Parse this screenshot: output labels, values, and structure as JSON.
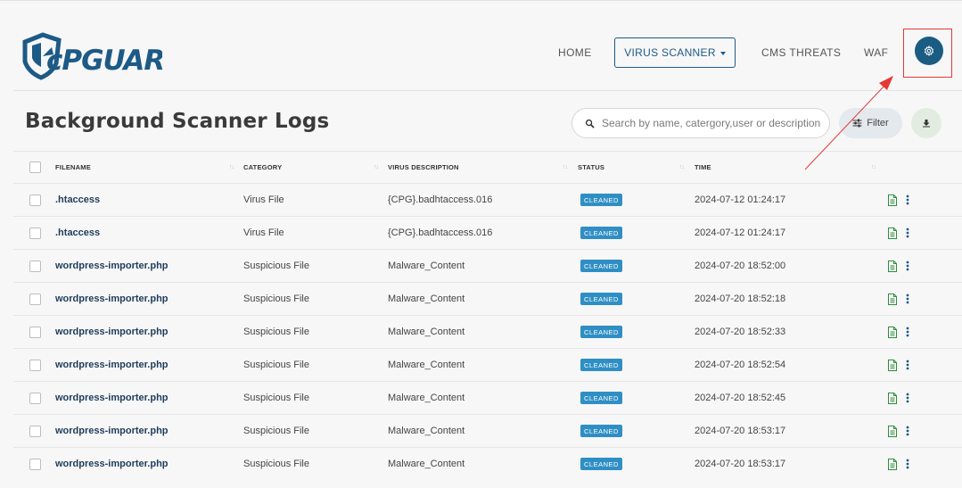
{
  "brand": {
    "logo_text": "cPGUARD",
    "logo_color": "#1d5a86"
  },
  "nav": {
    "items": [
      {
        "label": "HOME"
      },
      {
        "label": "VIRUS SCANNER",
        "active": true,
        "has_dropdown": true
      },
      {
        "label": "CMS THREATS"
      },
      {
        "label": "WAF"
      }
    ],
    "settings_icon": "gear-icon",
    "settings_highlighted": true,
    "highlight_color": "#e53935"
  },
  "page": {
    "title": "Background Scanner Logs",
    "search_placeholder": "Search by name, catergory,user or description",
    "filter_label": "Filter",
    "download_icon": "download-icon"
  },
  "table": {
    "columns": [
      "FILENAME",
      "CATEGORY",
      "VIRUS DESCRIPTION",
      "STATUS",
      "TIME"
    ],
    "rows": [
      {
        "filename": ".htaccess",
        "category": "Virus File",
        "description": "{CPG}.badhtaccess.016",
        "status": "CLEANED",
        "time": "2024-07-12 01:24:17"
      },
      {
        "filename": ".htaccess",
        "category": "Virus File",
        "description": "{CPG}.badhtaccess.016",
        "status": "CLEANED",
        "time": "2024-07-12 01:24:17"
      },
      {
        "filename": "wordpress-importer.php",
        "category": "Suspicious File",
        "description": "Malware_Content",
        "status": "CLEANED",
        "time": "2024-07-20 18:52:00"
      },
      {
        "filename": "wordpress-importer.php",
        "category": "Suspicious File",
        "description": "Malware_Content",
        "status": "CLEANED",
        "time": "2024-07-20 18:52:18"
      },
      {
        "filename": "wordpress-importer.php",
        "category": "Suspicious File",
        "description": "Malware_Content",
        "status": "CLEANED",
        "time": "2024-07-20 18:52:33"
      },
      {
        "filename": "wordpress-importer.php",
        "category": "Suspicious File",
        "description": "Malware_Content",
        "status": "CLEANED",
        "time": "2024-07-20 18:52:54"
      },
      {
        "filename": "wordpress-importer.php",
        "category": "Suspicious File",
        "description": "Malware_Content",
        "status": "CLEANED",
        "time": "2024-07-20 18:52:45"
      },
      {
        "filename": "wordpress-importer.php",
        "category": "Suspicious File",
        "description": "Malware_Content",
        "status": "CLEANED",
        "time": "2024-07-20 18:53:17"
      },
      {
        "filename": "wordpress-importer.php",
        "category": "Suspicious File",
        "description": "Malware_Content",
        "status": "CLEANED",
        "time": "2024-07-20 18:53:17"
      }
    ],
    "row_actions": [
      "file-icon",
      "more-vertical-icon"
    ],
    "status_color": "#2f8fc4"
  }
}
